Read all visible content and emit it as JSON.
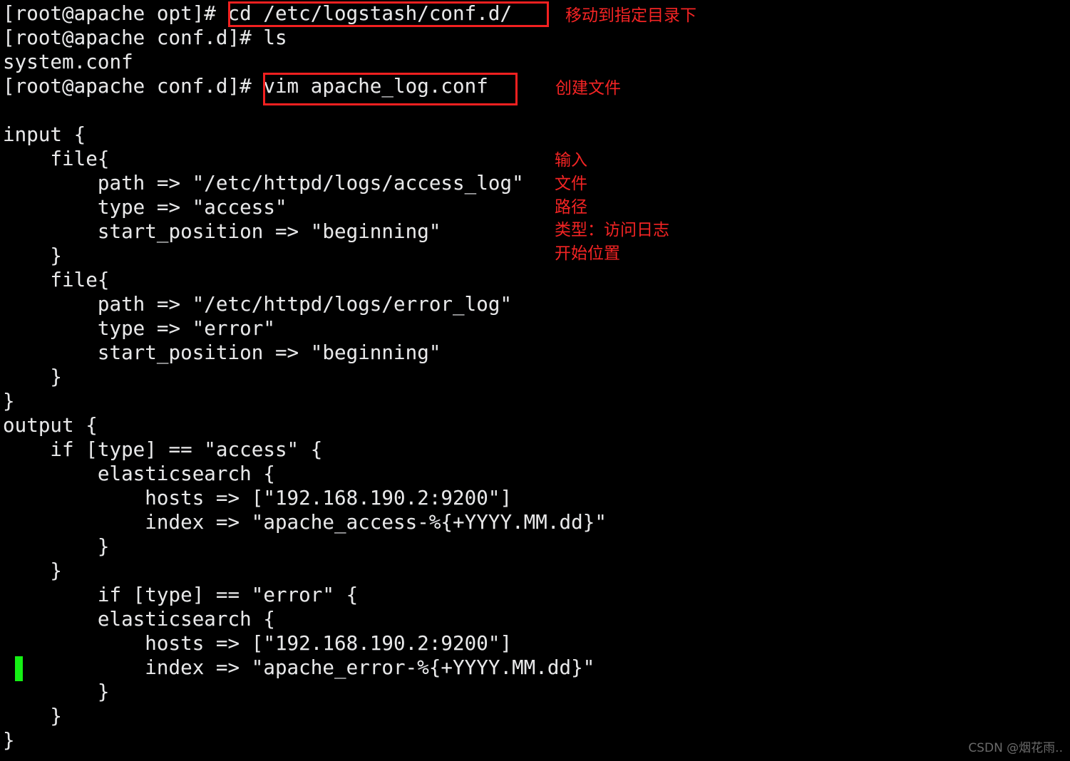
{
  "terminal": {
    "background_color": "#000000",
    "text_color": "#e8e8e8",
    "annotation_color": "#f42424",
    "cursor_color": "#14f014",
    "lines": [
      {
        "id": "l0",
        "text": "[root@apache opt]# cd /etc/logstash/conf.d/"
      },
      {
        "id": "l1",
        "text": "[root@apache conf.d]# ls"
      },
      {
        "id": "l2",
        "text": "system.conf"
      },
      {
        "id": "l3",
        "text": "[root@apache conf.d]# vim apache_log.conf"
      },
      {
        "id": "l4",
        "text": ""
      },
      {
        "id": "l5",
        "text": "input {"
      },
      {
        "id": "l6",
        "text": "    file{"
      },
      {
        "id": "l7",
        "text": "        path => \"/etc/httpd/logs/access_log\""
      },
      {
        "id": "l8",
        "text": "        type => \"access\""
      },
      {
        "id": "l9",
        "text": "        start_position => \"beginning\""
      },
      {
        "id": "l10",
        "text": "    }"
      },
      {
        "id": "l11",
        "text": "    file{"
      },
      {
        "id": "l12",
        "text": "        path => \"/etc/httpd/logs/error_log\""
      },
      {
        "id": "l13",
        "text": "        type => \"error\""
      },
      {
        "id": "l14",
        "text": "        start_position => \"beginning\""
      },
      {
        "id": "l15",
        "text": "    }"
      },
      {
        "id": "l16",
        "text": "}"
      },
      {
        "id": "l17",
        "text": "output {"
      },
      {
        "id": "l18",
        "text": "    if [type] == \"access\" {"
      },
      {
        "id": "l19",
        "text": "        elasticsearch {"
      },
      {
        "id": "l20",
        "text": "            hosts => [\"192.168.190.2:9200\"]"
      },
      {
        "id": "l21",
        "text": "            index => \"apache_access-%{+YYYY.MM.dd}\""
      },
      {
        "id": "l22",
        "text": "        }"
      },
      {
        "id": "l23",
        "text": "    }"
      },
      {
        "id": "l24",
        "text": ""
      },
      {
        "id": "l25",
        "text": "        if [type] == \"error\" {"
      },
      {
        "id": "l26",
        "text": "        elasticsearch {"
      },
      {
        "id": "l27",
        "text": "            hosts => [\"192.168.190.2:9200\"]"
      },
      {
        "id": "l28",
        "text": "            index => \"apache_error-%{+YYYY.MM.dd}\""
      },
      {
        "id": "l29",
        "text": "        }"
      },
      {
        "id": "l30",
        "text": "    }"
      },
      {
        "id": "l31",
        "text": "}"
      }
    ],
    "highlight_boxes": [
      {
        "id": "box-cd-command",
        "label": "cd /etc/logstash/conf.d/"
      },
      {
        "id": "box-vim-command",
        "label": "vim apache_log.conf"
      }
    ],
    "annotations": [
      {
        "id": "a0",
        "text": "移动到指定目录下"
      },
      {
        "id": "a1",
        "text": "创建文件"
      },
      {
        "id": "a2",
        "text": "输入"
      },
      {
        "id": "a3",
        "text": "文件"
      },
      {
        "id": "a4",
        "text": "路径"
      },
      {
        "id": "a5",
        "text": "类型：访问日志"
      },
      {
        "id": "a6",
        "text": "开始位置"
      }
    ],
    "cursor": {
      "visible": true
    },
    "watermark": "CSDN @烟花雨.."
  }
}
